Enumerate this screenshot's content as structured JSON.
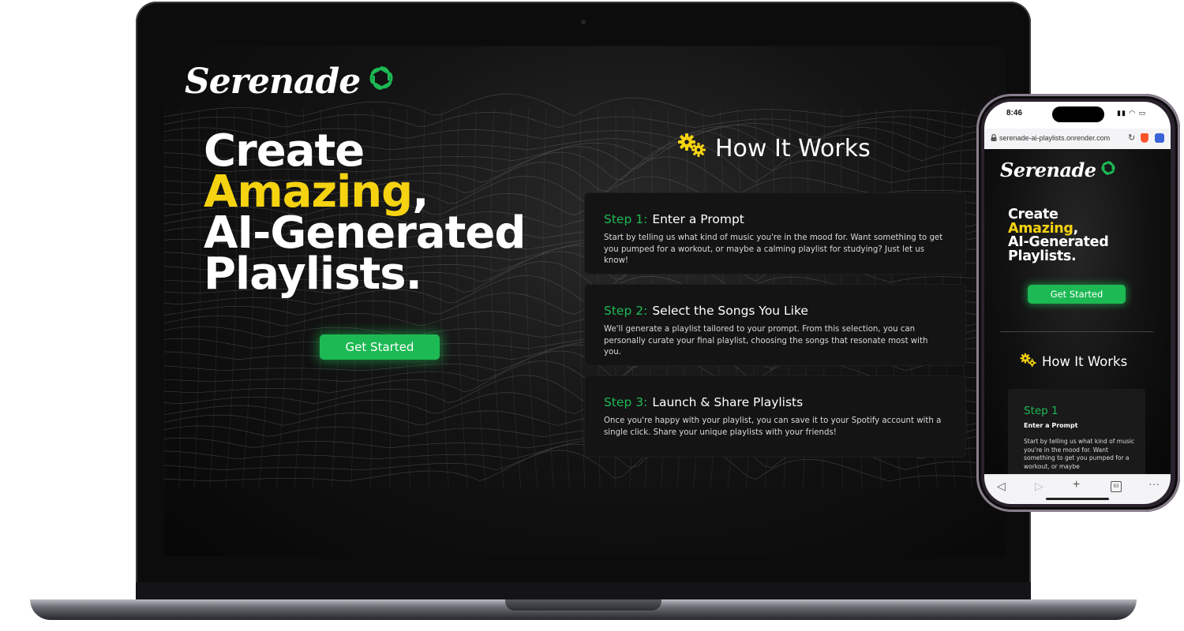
{
  "brand": {
    "name": "Serenade"
  },
  "hero": {
    "line1": "Create",
    "highlight": "Amazing",
    "highlight_suffix": ",",
    "line3": "AI-Generated",
    "line4": "Playlists."
  },
  "cta": {
    "label": "Get Started"
  },
  "how_it_works": {
    "title": "How It Works",
    "steps": [
      {
        "number": "Step 1:",
        "title": "Enter a Prompt",
        "description": "Start by telling us what kind of music you're in the mood for. Want something to get you pumped for a workout, or maybe a calming playlist for studying? Just let us know!"
      },
      {
        "number": "Step 2:",
        "title": "Select the Songs You Like",
        "description": "We'll generate a playlist tailored to your prompt. From this selection, you can personally curate your final playlist, choosing the songs that resonate most with you."
      },
      {
        "number": "Step 3:",
        "title": "Launch & Share Playlists",
        "description": "Once you're happy with your playlist, you can save it to your Spotify account with a single click. Share your unique playlists with your friends!"
      }
    ]
  },
  "phone": {
    "status_time": "8:46",
    "url": "serenade-ai-playlists.onrender.com",
    "tab_count": "63",
    "step_preview": {
      "number": "Step 1",
      "title": "Enter a Prompt",
      "description": "Start by telling us what kind of music you're in the mood for. Want something to get you pumped for a workout, or maybe"
    }
  },
  "colors": {
    "accent_green": "#1db954",
    "highlight_yellow": "#f5d311",
    "background": "#0b0b0b",
    "card": "#141414"
  },
  "icons": {
    "logo": "openai-swirl-icon",
    "how_it_works": "gears-icon"
  }
}
